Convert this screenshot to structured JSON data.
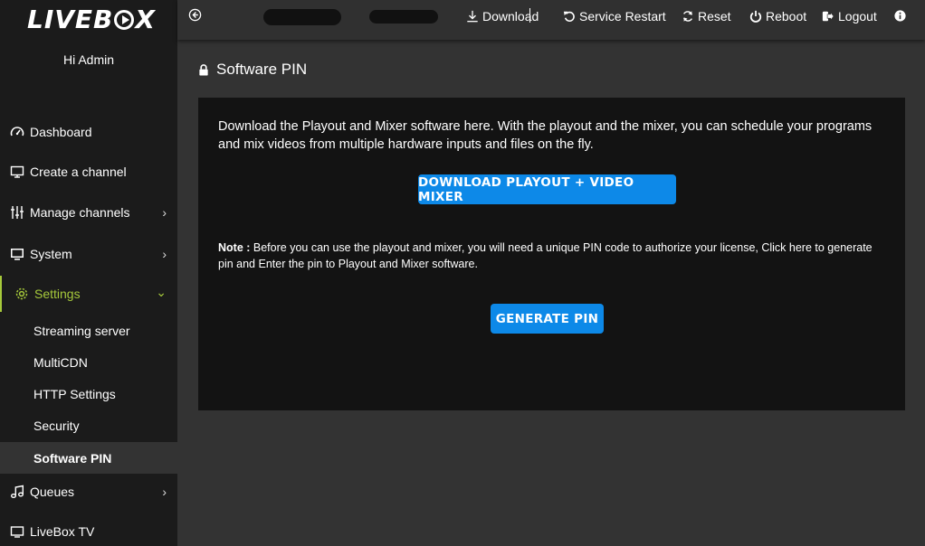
{
  "app": {
    "logo": "LIVEBOX",
    "greeting": "Hi Admin"
  },
  "sidebar": {
    "items": [
      {
        "label": "Dashboard",
        "icon": "gauge-icon"
      },
      {
        "label": "Create a channel",
        "icon": "monitor-icon"
      },
      {
        "label": "Manage channels",
        "icon": "sliders-icon",
        "expandable": true
      },
      {
        "label": "System",
        "icon": "desktop-icon",
        "expandable": true
      },
      {
        "label": "Settings",
        "icon": "gear-icon",
        "expandable": true,
        "expanded": true
      },
      {
        "label": "Queues",
        "icon": "music-icon",
        "expandable": true
      },
      {
        "label": "LiveBox TV",
        "icon": "tv-icon"
      }
    ],
    "settings_sub": [
      "Streaming server",
      "MultiCDN",
      "HTTP Settings",
      "Security",
      "Software PIN"
    ],
    "selected_sub": "Software PIN"
  },
  "topbar": {
    "download": "Download",
    "service_restart": "Service Restart",
    "reset": "Reset",
    "reboot": "Reboot",
    "logout": "Logout"
  },
  "page": {
    "title": "Software PIN",
    "description": "Download the Playout and Mixer software here. With the playout and the mixer, you can schedule your programs and mix videos from multiple hardware inputs and files on the fly.",
    "download_button": "DOWNLOAD PLAYOUT + VIDEO MIXER",
    "note_label": "Note :",
    "note_text": " Before you can use the playout and mixer, you will need a unique PIN code to authorize your license, Click here to generate pin and Enter the pin to Playout and Mixer software.",
    "generate_button": "GENERATE PIN"
  },
  "colors": {
    "accent": "#a6c93b",
    "button": "#0d89e8",
    "sidebar_bg": "#1b1b1b",
    "main_bg": "#333333",
    "panel_bg": "#131313"
  }
}
